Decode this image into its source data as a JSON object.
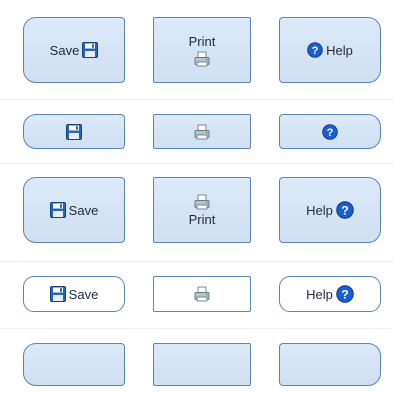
{
  "colors": {
    "button_fill": "#d5e5f6",
    "button_border": "#5b84b7",
    "text": "#1f2a38",
    "help_blue": "#1a5fd0",
    "save_blue": "#2a63b8"
  },
  "icons": {
    "save": "floppy-disk-icon",
    "print": "printer-icon",
    "help": "question-mark-icon"
  },
  "rows": {
    "row1": {
      "save_label": "Save",
      "print_label": "Print",
      "help_label": "Help"
    },
    "row3": {
      "save_label": "Save",
      "print_label": "Print",
      "help_label": "Help"
    },
    "row4": {
      "save_label": "Save",
      "help_label": "Help"
    }
  }
}
